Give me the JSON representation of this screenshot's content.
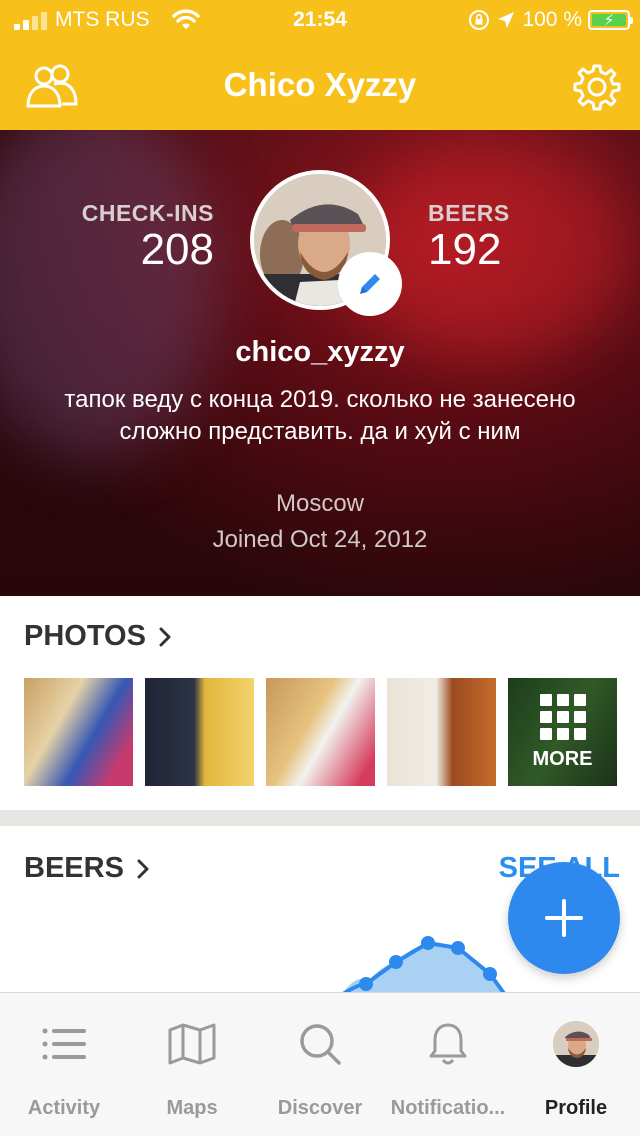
{
  "status_bar": {
    "carrier": "MTS RUS",
    "time": "21:54",
    "battery": "100 %"
  },
  "nav": {
    "title": "Chico Xyzzy",
    "left_icon": "friends-icon",
    "right_icon": "gear-icon"
  },
  "profile": {
    "checkins_label": "CHECK-INS",
    "checkins_value": "208",
    "beers_label": "BEERS",
    "beers_value": "192",
    "username": "chico_xyzzy",
    "bio": "тапок веду с конца 2019. сколько не занесено сложно представить. да и хуй с ним",
    "location": "Moscow",
    "joined": "Joined Oct 24, 2012"
  },
  "photos": {
    "title": "PHOTOS",
    "more_label": "MORE",
    "count_visible": 5
  },
  "beers_section": {
    "title": "BEERS",
    "see_all": "SEE ALL"
  },
  "tabs": [
    {
      "label": "Activity",
      "icon": "list-icon"
    },
    {
      "label": "Maps",
      "icon": "map-icon"
    },
    {
      "label": "Discover",
      "icon": "search-icon"
    },
    {
      "label": "Notificatio...",
      "icon": "bell-icon"
    },
    {
      "label": "Profile",
      "icon": "avatar"
    }
  ],
  "colors": {
    "accent_yellow": "#f8c01b",
    "accent_blue": "#2e89ef"
  }
}
